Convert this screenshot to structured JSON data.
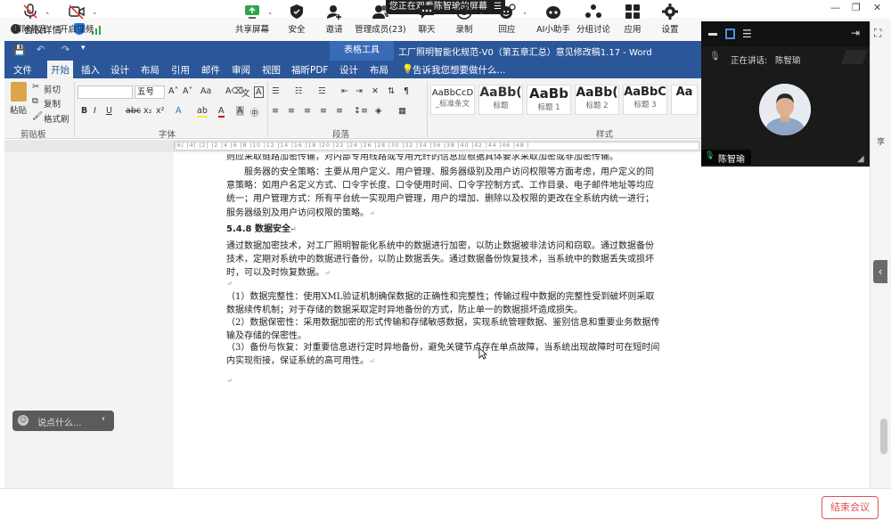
{
  "share_banner": {
    "text": "您正在观看陈智瑜的屏幕",
    "icon": "menu-icon"
  },
  "window_controls": {
    "minimize": "—",
    "restore": "❐",
    "close": "✕"
  },
  "meeting_info": {
    "label": "会议详情"
  },
  "word": {
    "title": "工厂照明智能化规范-V0（第五章汇总）意见修改稿1.17  -  Word",
    "context_tab": "表格工具",
    "tabs": [
      "文件",
      "开始",
      "插入",
      "设计",
      "布局",
      "引用",
      "邮件",
      "审阅",
      "视图",
      "福昕PDF",
      "设计",
      "布局"
    ],
    "tell_me": "告诉我您想要做什么...",
    "clipboard": {
      "paste": "粘贴",
      "cut": "剪切",
      "copy": "复制",
      "painter": "格式刷",
      "label": "剪贴板"
    },
    "font": {
      "size": "五号",
      "label": "字体"
    },
    "paragraph": {
      "label": "段落"
    },
    "styles": {
      "label": "样式",
      "items": [
        {
          "preview": "AaBbCcD",
          "name": "_标准条文"
        },
        {
          "preview": "AaBb(",
          "name": "标题"
        },
        {
          "preview": "AaBb",
          "name": "标题 1"
        },
        {
          "preview": "AaBb(",
          "name": "标题 2"
        },
        {
          "preview": "AaBbC",
          "name": "标题 3"
        },
        {
          "preview": "Aa",
          "name": ""
        }
      ]
    }
  },
  "document": {
    "line_top": "则应采取链路加密传输，对内部专用线路或专用光纤的信息应根据具体要求采取加密或非加密传输。",
    "para1": "服务器的安全策略：主要从用户定义、用户管理、服务器级别及用户访问权限等方面考虑，用户定义的同意策略：如用户名定义方式、口令字长度、口令使用时间、口令字控制方式、工作目录、电子邮件地址等均应统一；用户管理方式：所有平台统一实现用户管理，用户的增加、删除以及权限的更改在全系统内统一进行；服务器级别及用户访问权限的策略。",
    "heading": "5.4.8  数据安全",
    "para2": "通过数据加密技术，对工厂照明智能化系统中的数据进行加密，以防止数据被非法访问和窃取。通过数据备份技术，定期对系统中的数据进行备份，以防止数据丢失。通过数据备份恢复技术，当系统中的数据丢失或损坏时，可以及时恢复数据。",
    "item1": "（1）数据完整性：使用XML验证机制确保数据的正确性和完整性；传输过程中数据的完整性受到破坏则采取数据续传机制；对于存储的数据采取定时异地备份的方式，防止单一的数据损坏造成损失。",
    "item2": "（2）数据保密性：采用数据加密的形式传输和存储敏感数据，实现系统管理数据、鉴别信息和重要业务数据传输及存储的保密性。",
    "item3": "（3）备份与恢复：对重要信息进行定时异地备份，避免关键节点存在单点故障，当系统出现故障时可在短时间内实现衔接，保证系统的高可用性。",
    "para_mark": "↵"
  },
  "video": {
    "speaking_label": "正在讲话:",
    "speaker": "陈智瑜",
    "name_tag": "陈智瑜"
  },
  "chat": {
    "placeholder": "说点什么..."
  },
  "toolbar": {
    "left": [
      {
        "label": "解除静音",
        "icon": "mic-muted-icon"
      },
      {
        "label": "开启视频",
        "icon": "camera-off-icon"
      }
    ],
    "center": [
      {
        "label": "共享屏幕",
        "icon": "share-screen-icon"
      },
      {
        "label": "安全",
        "icon": "shield-icon"
      },
      {
        "label": "邀请",
        "icon": "invite-icon"
      },
      {
        "label": "管理成员(23)",
        "icon": "members-icon"
      },
      {
        "label": "聊天",
        "icon": "chat-icon"
      },
      {
        "label": "录制",
        "icon": "record-icon"
      },
      {
        "label": "回应",
        "icon": "reaction-icon"
      },
      {
        "label": "AI小助手",
        "icon": "ai-assistant-icon"
      },
      {
        "label": "分组讨论",
        "icon": "breakout-icon"
      },
      {
        "label": "应用",
        "icon": "apps-icon"
      },
      {
        "label": "设置",
        "icon": "settings-icon"
      }
    ],
    "end_meeting": "结束会议"
  },
  "colors": {
    "word_blue": "#2b579a",
    "end_red": "#e25050",
    "accent": "#1a73e8"
  }
}
